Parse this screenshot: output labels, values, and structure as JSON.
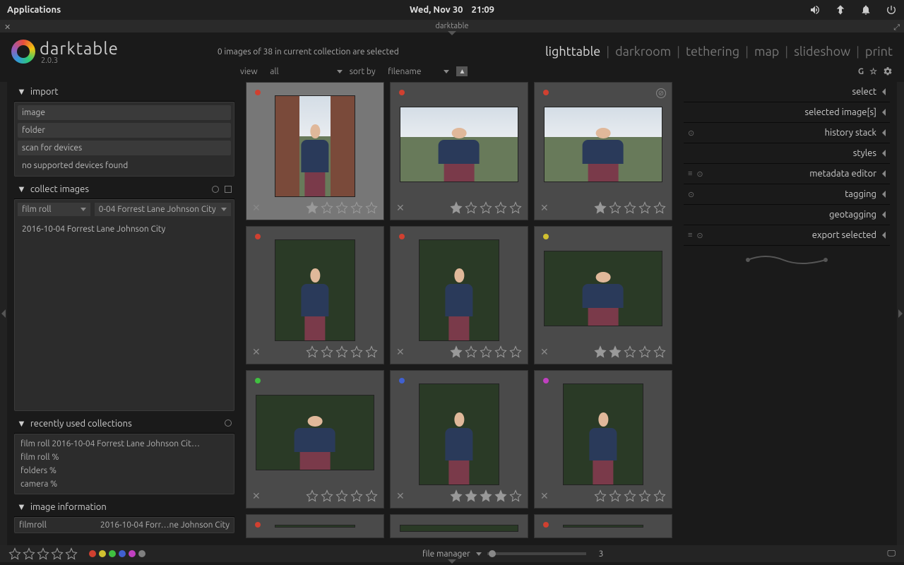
{
  "sysbar": {
    "applications": "Applications",
    "date": "Wed, Nov 30",
    "time": "21:09"
  },
  "window": {
    "title": "darktable"
  },
  "app": {
    "name": "darktable",
    "version": "2.0.3"
  },
  "status": "0 images of 38 in current collection are selected",
  "views": [
    "lighttable",
    "darkroom",
    "tethering",
    "map",
    "slideshow",
    "print"
  ],
  "filter": {
    "view_label": "view",
    "view_value": "all",
    "sort_label": "sort by",
    "sort_value": "filename",
    "g": "G"
  },
  "left": {
    "import": {
      "title": "import",
      "items": [
        "image",
        "folder",
        "scan for devices",
        "no supported devices found"
      ]
    },
    "collect": {
      "title": "collect images",
      "attr": "film roll",
      "value": "0-04 Forrest Lane Johnson City",
      "results": [
        "2016-10-04 Forrest Lane Johnson City"
      ]
    },
    "recent": {
      "title": "recently used collections",
      "items": [
        "film roll 2016-10-04 Forrest Lane Johnson Cit…",
        "film roll %",
        "folders %",
        "camera %"
      ]
    },
    "info": {
      "title": "image information",
      "row_label": "filmroll",
      "row_value": "2016-10-04 Forr…ne Johnson City"
    }
  },
  "right": {
    "modules": [
      "select",
      "selected image[s]",
      "history stack",
      "styles",
      "metadata editor",
      "tagging",
      "geotagging",
      "export selected"
    ]
  },
  "bottom": {
    "filemanager": "file manager",
    "zoom": "3"
  },
  "colors": {
    "red": "#d04030",
    "yellow": "#d0c030",
    "green": "#40c040",
    "blue": "#4060d0",
    "magenta": "#c040c0",
    "grey": "#808080"
  }
}
